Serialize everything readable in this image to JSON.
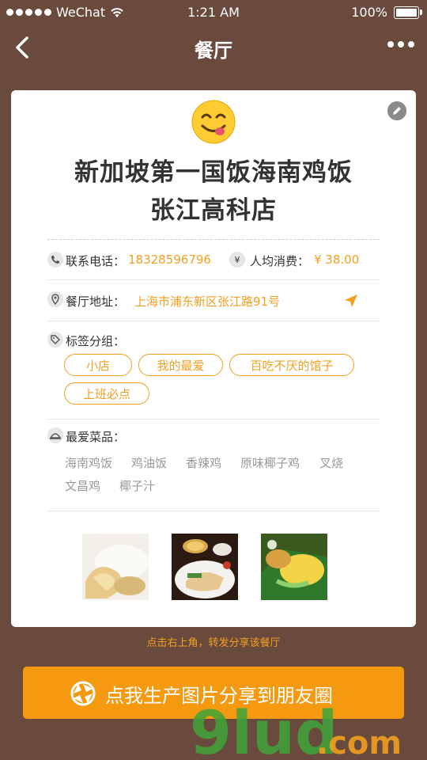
{
  "status_bar": {
    "carrier": "WeChat",
    "time": "1:21 AM",
    "battery": "100%"
  },
  "nav": {
    "title": "餐厅"
  },
  "restaurant": {
    "name_line1": "新加坡第一国饭海南鸡饭",
    "name_line2": "张江高科店",
    "phone_label": "联系电话：",
    "phone": "18328596796",
    "avg_label": "人均消费：",
    "avg_price": "¥ 38.00",
    "address_label": "餐厅地址：",
    "address": "上海市浦东新区张江路91号",
    "tags_label": "标签分组：",
    "tags": [
      "小店",
      "我的最爱",
      "百吃不厌的馆子",
      "上班必点"
    ],
    "dishes_label": "最爱菜品：",
    "dishes": [
      "海南鸡饭",
      "鸡油饭",
      "香辣鸡",
      "原味椰子鸡",
      "叉烧",
      "文昌鸡",
      "椰子汁"
    ]
  },
  "hint": "点击右上角，转发分享该餐厅",
  "share_button": {
    "label": "点我生产图片分享到朋友圈"
  },
  "watermark": {
    "text": "9lud.com"
  },
  "colors": {
    "background": "#6b4a3e",
    "accent": "#f0a020",
    "button": "#f59a10"
  }
}
